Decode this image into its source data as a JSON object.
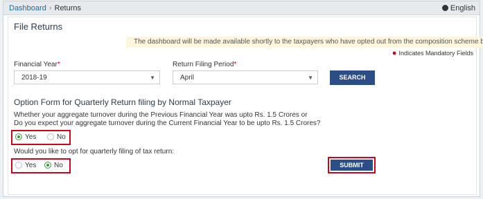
{
  "breadcrumb": {
    "link": "Dashboard",
    "separator": "›",
    "current": "Returns"
  },
  "language": "English",
  "page_title": "File Returns",
  "notice": "The dashboard will be made available shortly to the taxpayers who have opted out from the composition scheme by f",
  "mandatory_note": "Indicates Mandatory Fields",
  "form": {
    "financial_year": {
      "label": "Financial Year",
      "required": "*",
      "value": "2018-19"
    },
    "return_period": {
      "label": "Return Filing Period",
      "required": "*",
      "value": "April"
    },
    "search_label": "SEARCH"
  },
  "option_form": {
    "title": "Option Form for Quarterly Return filing by Normal Taxpayer",
    "q1_line1": "Whether your aggregate turnover during the Previous Financial Year was upto Rs. 1.5 Crores or",
    "q1_line2": "Do you expect your aggregate turnover during the Current Financial Year to be upto Rs. 1.5 Crores?",
    "q1_yes": "Yes",
    "q1_no": "No",
    "q2": "Would you like to opt for quarterly filing of tax return:",
    "q2_yes": "Yes",
    "q2_no": "No",
    "submit_label": "SUBMIT"
  },
  "colors": {
    "primary_button": "#2c4e86",
    "required": "#d0021b",
    "radio_selected": "#3c9a3c",
    "highlight_box": "#d0021b"
  }
}
